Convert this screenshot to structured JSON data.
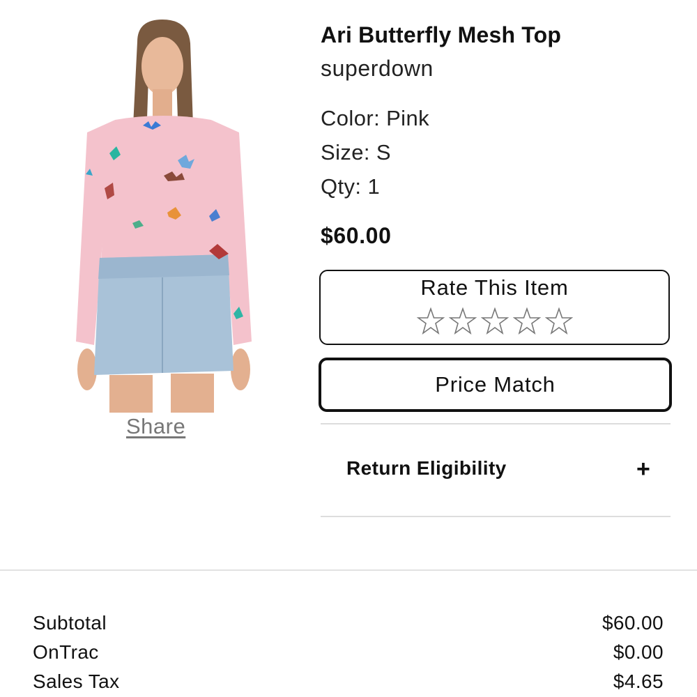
{
  "product": {
    "name": "Ari Butterfly Mesh Top",
    "brand": "superdown",
    "color": "Color: Pink",
    "size": "Size: S",
    "qty": "Qty: 1",
    "price": "$60.00",
    "share_label": "Share"
  },
  "rating": {
    "title": "Rate This Item",
    "max_stars": 5,
    "current": 0
  },
  "price_match_label": "Price Match",
  "return_eligibility": {
    "label": "Return Eligibility",
    "toggle": "+"
  },
  "summary": {
    "subtotal_label": "Subtotal",
    "subtotal_value": "$60.00",
    "shipping_label": "OnTrac",
    "shipping_value": "$0.00",
    "tax_label": "Sales Tax",
    "tax_value": "$4.65"
  },
  "colors": {
    "top_pink": "#f4c2cc",
    "denim": "#a9c2d8",
    "text": "#111111",
    "divider": "#dddddd"
  }
}
